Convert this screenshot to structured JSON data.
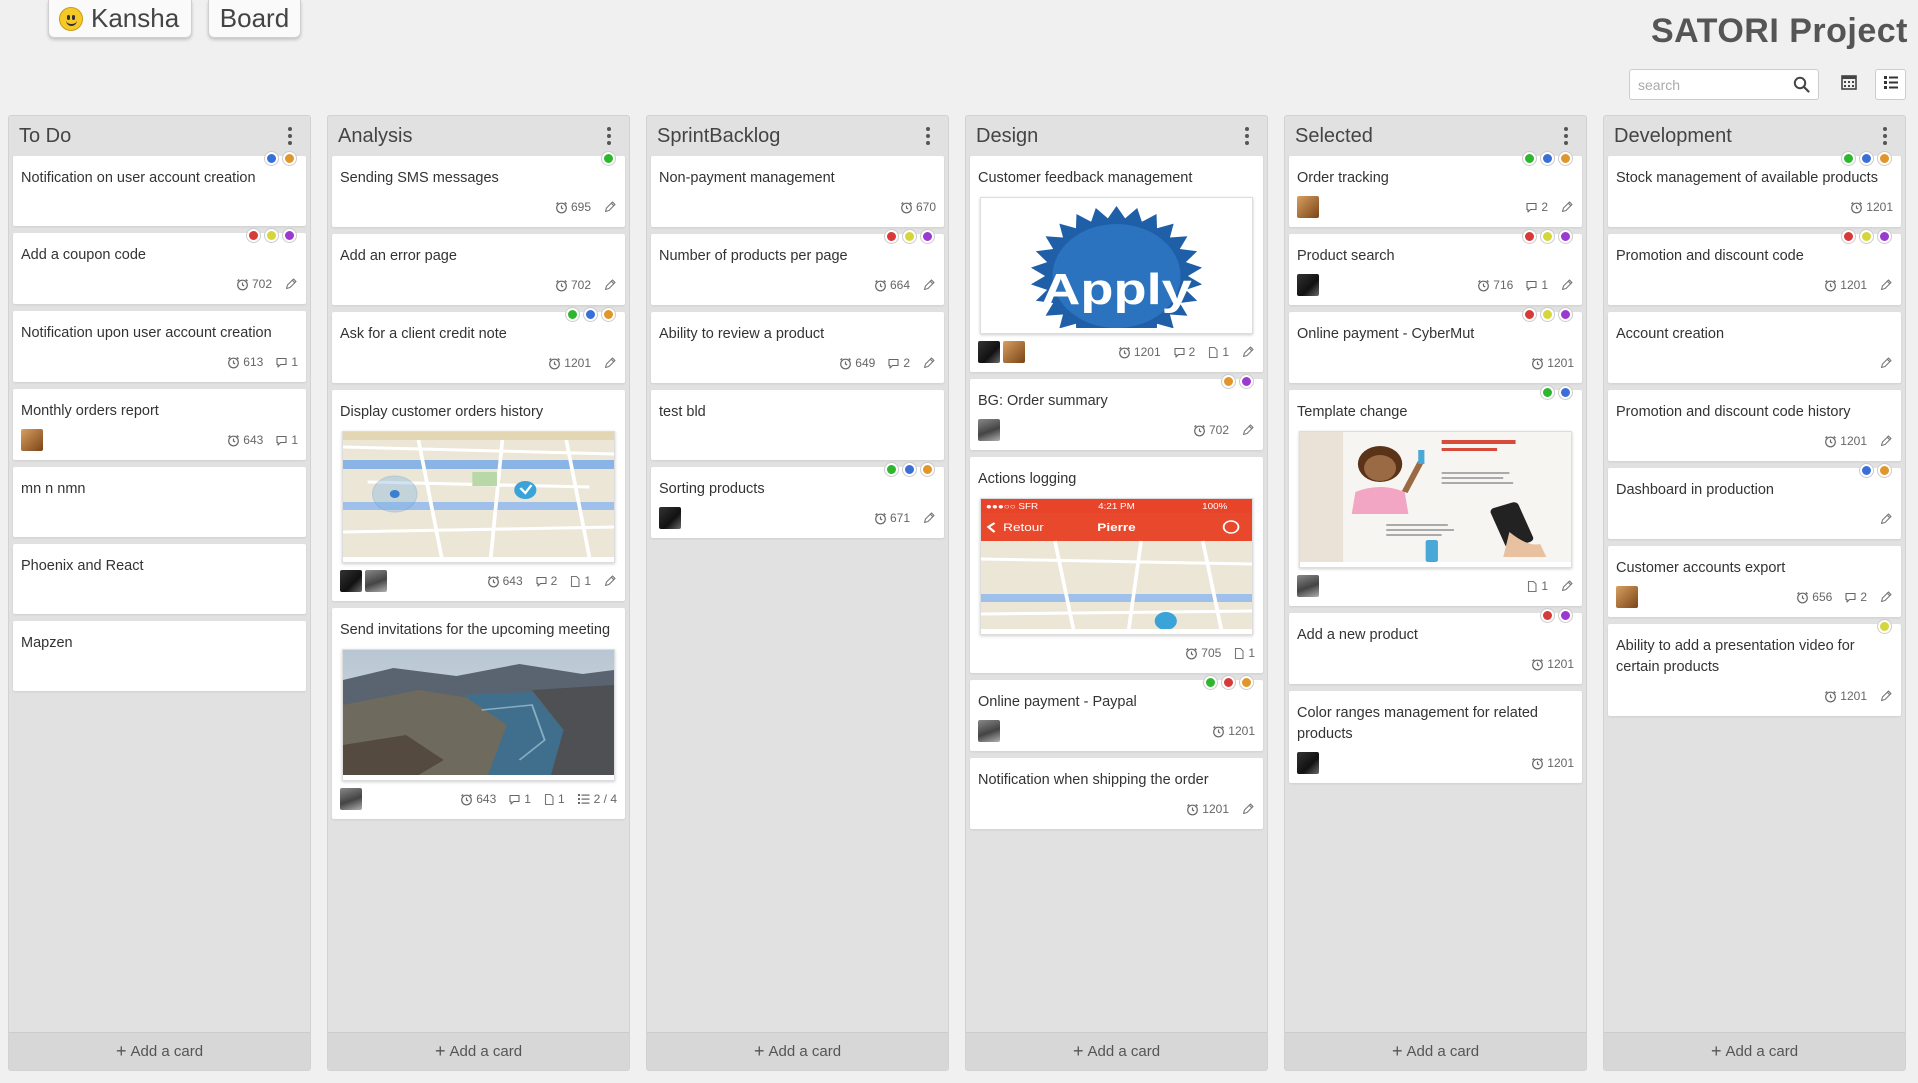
{
  "header": {
    "app_name": "Kansha",
    "board_label": "Board",
    "project_title": "SATORI Project",
    "search_placeholder": "search"
  },
  "colors": {
    "green": "#2fb62f",
    "blue": "#3a6fd8",
    "orange": "#e0962a",
    "red": "#d83a3a",
    "yellow": "#d4d63a",
    "purple": "#9a3ad0"
  },
  "add_card_label": "Add a card",
  "columns": [
    {
      "title": "To Do",
      "cards": [
        {
          "title": "Notification on user account creation",
          "dots": [
            "blue",
            "orange"
          ]
        },
        {
          "title": "Add a coupon code",
          "dots": [
            "red",
            "yellow",
            "purple"
          ],
          "time": "702",
          "edit": true
        },
        {
          "title": "Notification upon user account creation",
          "time": "613",
          "comments": "1"
        },
        {
          "title": "Monthly orders report",
          "avatars": [
            "warm"
          ],
          "time": "643",
          "comments": "1"
        },
        {
          "title": "mn n nmn"
        },
        {
          "title": "Phoenix and React"
        },
        {
          "title": "Mapzen"
        }
      ]
    },
    {
      "title": "Analysis",
      "cards": [
        {
          "title": "Sending SMS messages",
          "dots": [
            "green"
          ],
          "time": "695",
          "edit": true
        },
        {
          "title": "Add an error page",
          "time": "702",
          "edit": true
        },
        {
          "title": "Ask for a client credit note",
          "dots": [
            "green",
            "blue",
            "orange"
          ],
          "time": "1201",
          "edit": true
        },
        {
          "title": "Display customer orders history",
          "image": "map",
          "avatars": [
            "dark",
            "gray"
          ],
          "time": "643",
          "comments": "2",
          "files": "1",
          "edit": true
        },
        {
          "title": "Send invitations for the upcoming meeting",
          "image": "fjord",
          "avatars": [
            "gray"
          ],
          "time": "643",
          "comments": "1",
          "files": "1",
          "checklist": "2 / 4"
        }
      ]
    },
    {
      "title": "SprintBacklog",
      "cards": [
        {
          "title": "Non-payment management",
          "time": "670"
        },
        {
          "title": "Number of products per page",
          "dots": [
            "red",
            "yellow",
            "purple"
          ],
          "time": "664",
          "edit": true
        },
        {
          "title": "Ability to review a product",
          "time": "649",
          "comments": "2",
          "edit": true
        },
        {
          "title": "test bld"
        },
        {
          "title": "Sorting products",
          "dots": [
            "green",
            "blue",
            "orange"
          ],
          "avatars": [
            "dark"
          ],
          "time": "671",
          "edit": true
        }
      ]
    },
    {
      "title": "Design",
      "cards": [
        {
          "title": "Customer feedback management",
          "image": "apply",
          "avatars": [
            "dark",
            "warm"
          ],
          "time": "1201",
          "comments": "2",
          "files": "1",
          "edit": true
        },
        {
          "title": "BG: Order summary",
          "dots": [
            "orange",
            "purple"
          ],
          "avatars": [
            "gray"
          ],
          "time": "702",
          "edit": true
        },
        {
          "title": "Actions logging",
          "image": "phone",
          "time": "705",
          "files": "1"
        },
        {
          "title": "Online payment - Paypal",
          "dots": [
            "green",
            "red",
            "orange"
          ],
          "avatars": [
            "gray"
          ],
          "time": "1201"
        },
        {
          "title": "Notification when shipping the order",
          "time": "1201",
          "edit": true
        }
      ]
    },
    {
      "title": "Selected",
      "cards": [
        {
          "title": "Order tracking",
          "dots": [
            "green",
            "blue",
            "orange"
          ],
          "avatars": [
            "warm"
          ],
          "comments": "2",
          "edit": true
        },
        {
          "title": "Product search",
          "dots": [
            "red",
            "yellow",
            "purple"
          ],
          "avatars": [
            "dark"
          ],
          "time": "716",
          "comments": "1",
          "edit": true
        },
        {
          "title": "Online payment - CyberMut",
          "dots": [
            "red",
            "yellow",
            "purple"
          ],
          "time": "1201"
        },
        {
          "title": "Template change",
          "dots": [
            "green",
            "blue"
          ],
          "image": "kid",
          "avatars": [
            "gray"
          ],
          "files": "1",
          "edit": true
        },
        {
          "title": "Add a new product",
          "dots": [
            "red",
            "purple"
          ],
          "time": "1201"
        },
        {
          "title": "Color ranges management for related products",
          "avatars": [
            "dark"
          ],
          "time": "1201"
        }
      ]
    },
    {
      "title": "Development",
      "cards": [
        {
          "title": "Stock management of available products",
          "dots": [
            "green",
            "blue",
            "orange"
          ],
          "time": "1201"
        },
        {
          "title": "Promotion and discount code",
          "dots": [
            "red",
            "yellow",
            "purple"
          ],
          "time": "1201",
          "edit": true
        },
        {
          "title": "Account creation",
          "edit": true
        },
        {
          "title": "Promotion and discount code history",
          "time": "1201",
          "edit": true
        },
        {
          "title": "Dashboard in production",
          "dots": [
            "blue",
            "orange"
          ],
          "edit": true
        },
        {
          "title": "Customer accounts export",
          "avatars": [
            "warm"
          ],
          "time": "656",
          "comments": "2",
          "edit": true
        },
        {
          "title": "Ability to add a presentation video for certain products",
          "dots": [
            "yellow"
          ],
          "time": "1201",
          "edit": true
        }
      ]
    }
  ],
  "images": {
    "phone": {
      "carrier": "SFR",
      "time": "4:21 PM",
      "battery": "100%",
      "back": "Retour",
      "name": "Pierre"
    },
    "apply": {
      "text": "Apply"
    }
  }
}
